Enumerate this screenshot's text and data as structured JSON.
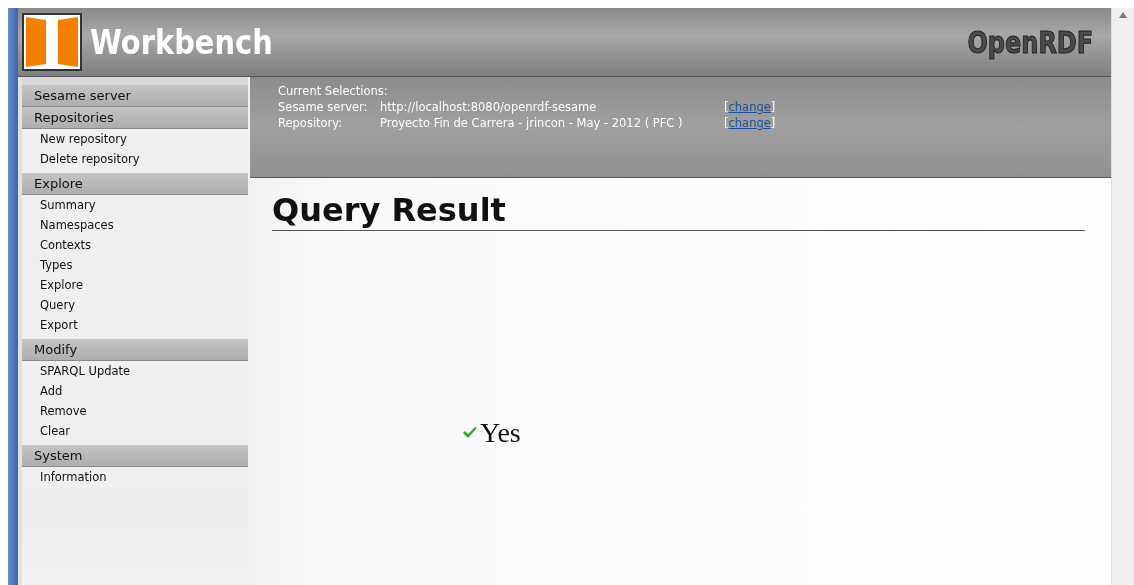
{
  "header": {
    "title": "Workbench",
    "brand": "OpenRDF"
  },
  "sidebar": {
    "sections": [
      {
        "title": "Sesame server"
      },
      {
        "title": "Repositories",
        "items": [
          "New repository",
          "Delete repository"
        ]
      },
      {
        "title": "Explore",
        "items": [
          "Summary",
          "Namespaces",
          "Contexts",
          "Types",
          "Explore",
          "Query",
          "Export"
        ]
      },
      {
        "title": "Modify",
        "items": [
          "SPARQL Update",
          "Add",
          "Remove",
          "Clear"
        ]
      },
      {
        "title": "System",
        "items": [
          "Information"
        ]
      }
    ]
  },
  "selections": {
    "heading": "Current Selections:",
    "rows": [
      {
        "label": "Sesame server:",
        "value": "http://localhost:8080/openrdf-sesame",
        "open": "[",
        "link": "change",
        "close": "]"
      },
      {
        "label": "Repository:",
        "value": "Proyecto Fin de Carrera - jrincon - May - 2012 ( PFC )",
        "open": "[",
        "link": "change",
        "close": "]"
      }
    ]
  },
  "page_title": "Query Result",
  "result": {
    "answer": "Yes",
    "success": true
  }
}
